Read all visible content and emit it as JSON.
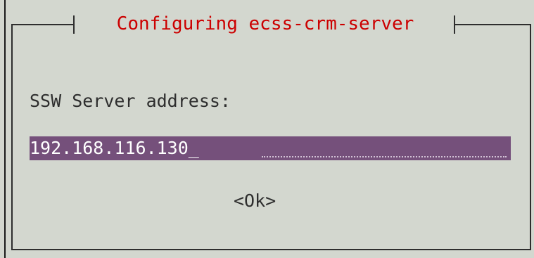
{
  "dialog": {
    "title": "Configuring ecss-crm-server",
    "prompt": "SSW Server address:",
    "input_value": "192.168.116.130",
    "cursor": "_",
    "ok_label": "<Ok>"
  },
  "colors": {
    "background": "#d3d7cf",
    "title": "#cc0000",
    "input_background": "#75507b",
    "input_text": "#ffffff",
    "text": "#2e2e2e"
  }
}
